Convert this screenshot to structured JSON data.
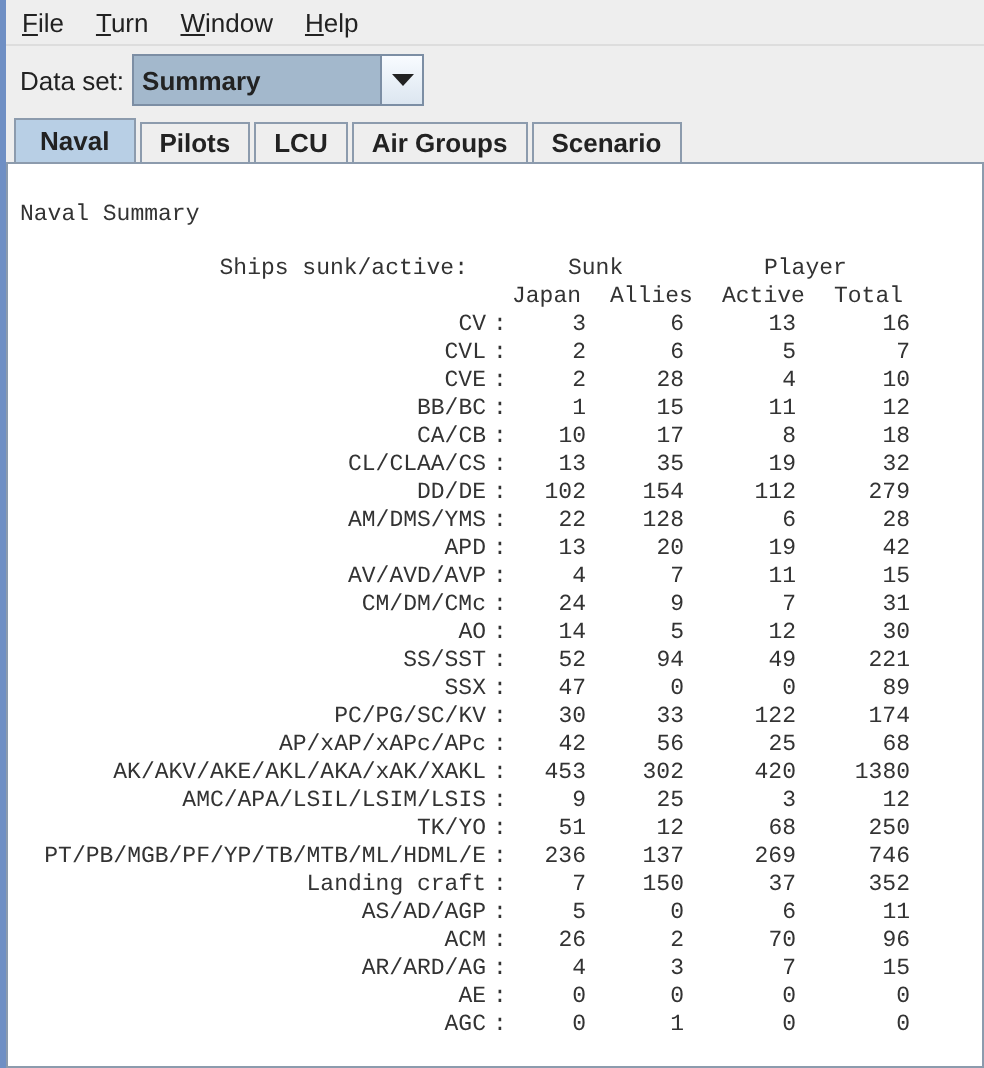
{
  "menu": [
    "File",
    "Turn",
    "Window",
    "Help"
  ],
  "data_set": {
    "label": "Data set:",
    "value": "Summary"
  },
  "tabs": [
    {
      "label": "Naval",
      "selected": true
    },
    {
      "label": "Pilots",
      "selected": false
    },
    {
      "label": "LCU",
      "selected": false
    },
    {
      "label": "Air Groups",
      "selected": false
    },
    {
      "label": "Scenario",
      "selected": false
    }
  ],
  "report": {
    "title": "Naval Summary",
    "caption": "Ships sunk/active:",
    "group_headers": [
      "Sunk",
      "Player"
    ],
    "columns": [
      "Japan",
      "Allies",
      "Active",
      "Total"
    ],
    "rows": [
      {
        "type": "CV",
        "values": [
          "3",
          "6",
          "13",
          "16"
        ]
      },
      {
        "type": "CVL",
        "values": [
          "2",
          "6",
          "5",
          "7"
        ]
      },
      {
        "type": "CVE",
        "values": [
          "2",
          "28",
          "4",
          "10"
        ]
      },
      {
        "type": "BB/BC",
        "values": [
          "1",
          "15",
          "11",
          "12"
        ]
      },
      {
        "type": "CA/CB",
        "values": [
          "10",
          "17",
          "8",
          "18"
        ]
      },
      {
        "type": "CL/CLAA/CS",
        "values": [
          "13",
          "35",
          "19",
          "32"
        ]
      },
      {
        "type": "DD/DE",
        "values": [
          "102",
          "154",
          "112",
          "279"
        ]
      },
      {
        "type": "AM/DMS/YMS",
        "values": [
          "22",
          "128",
          "6",
          "28"
        ]
      },
      {
        "type": "APD",
        "values": [
          "13",
          "20",
          "19",
          "42"
        ]
      },
      {
        "type": "AV/AVD/AVP",
        "values": [
          "4",
          "7",
          "11",
          "15"
        ]
      },
      {
        "type": "CM/DM/CMc",
        "values": [
          "24",
          "9",
          "7",
          "31"
        ]
      },
      {
        "type": "AO",
        "values": [
          "14",
          "5",
          "12",
          "30"
        ]
      },
      {
        "type": "SS/SST",
        "values": [
          "52",
          "94",
          "49",
          "221"
        ]
      },
      {
        "type": "SSX",
        "values": [
          "47",
          "0",
          "0",
          "89"
        ]
      },
      {
        "type": "PC/PG/SC/KV",
        "values": [
          "30",
          "33",
          "122",
          "174"
        ]
      },
      {
        "type": "AP/xAP/xAPc/APc",
        "values": [
          "42",
          "56",
          "25",
          "68"
        ]
      },
      {
        "type": "AK/AKV/AKE/AKL/AKA/xAK/XAKL",
        "values": [
          "453",
          "302",
          "420",
          "1380"
        ]
      },
      {
        "type": "AMC/APA/LSIL/LSIM/LSIS",
        "values": [
          "9",
          "25",
          "3",
          "12"
        ]
      },
      {
        "type": "TK/YO",
        "values": [
          "51",
          "12",
          "68",
          "250"
        ]
      },
      {
        "type": "PT/PB/MGB/PF/YP/TB/MTB/ML/HDML/E",
        "values": [
          "236",
          "137",
          "269",
          "746"
        ]
      },
      {
        "type": "Landing craft",
        "values": [
          "7",
          "150",
          "37",
          "352"
        ]
      },
      {
        "type": "AS/AD/AGP",
        "values": [
          "5",
          "0",
          "6",
          "11"
        ]
      },
      {
        "type": "ACM",
        "values": [
          "26",
          "2",
          "70",
          "96"
        ]
      },
      {
        "type": "AR/ARD/AG",
        "values": [
          "4",
          "3",
          "7",
          "15"
        ]
      },
      {
        "type": "AE",
        "values": [
          "0",
          "0",
          "0",
          "0"
        ]
      },
      {
        "type": "AGC",
        "values": [
          "0",
          "1",
          "0",
          "0"
        ]
      }
    ],
    "separator": ":"
  }
}
